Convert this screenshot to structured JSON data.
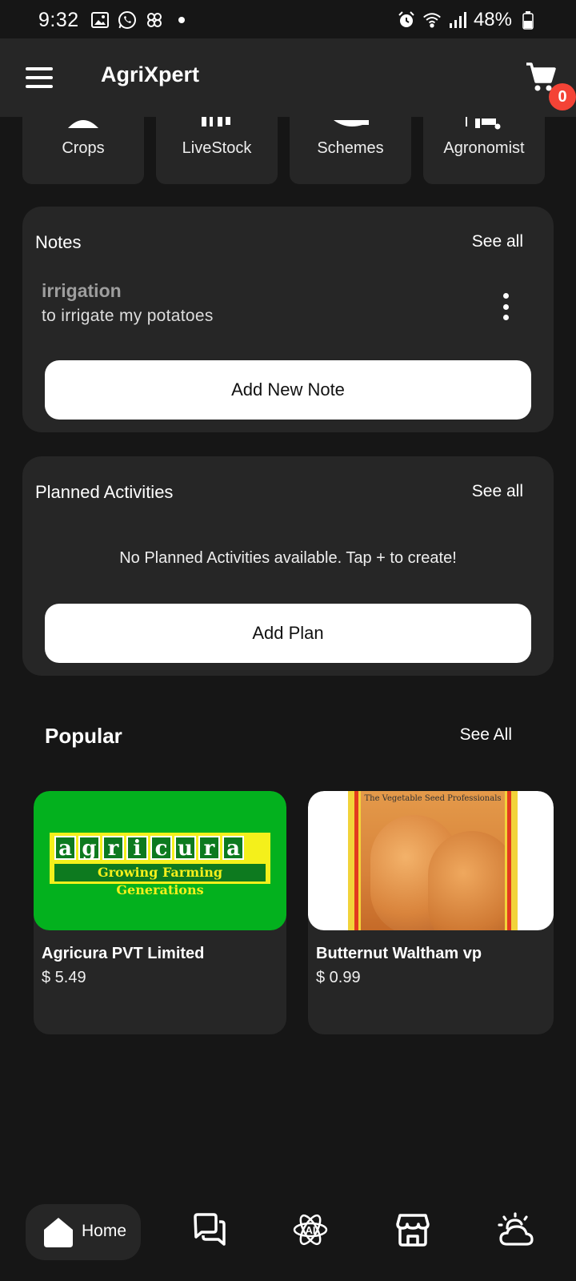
{
  "status_bar": {
    "time": "9:32",
    "battery": "48%",
    "left_icons": [
      "gallery-icon",
      "whatsapp-icon",
      "pinwheel-icon",
      "dot-icon"
    ],
    "right_icons": [
      "alarm-icon",
      "wifi-icon",
      "signal-icon",
      "battery-icon"
    ]
  },
  "app_bar": {
    "title": "AgriXpert",
    "cart_count": "0"
  },
  "categories": [
    {
      "label": "Crops",
      "icon": "crops-icon"
    },
    {
      "label": "LiveStock",
      "icon": "livestock-icon"
    },
    {
      "label": "Schemes",
      "icon": "schemes-icon"
    },
    {
      "label": "Agronomist",
      "icon": "agronomist-icon"
    }
  ],
  "notes": {
    "title": "Notes",
    "see_all": "See all",
    "items": [
      {
        "title": "irrigation",
        "body": "to irrigate my potatoes"
      }
    ],
    "add_button": "Add New Note"
  },
  "planned_activities": {
    "title": "Planned Activities",
    "see_all": "See all",
    "empty_text": "No Planned Activities available. Tap + to create!",
    "add_button": "Add Plan"
  },
  "popular": {
    "title": "Popular",
    "see_all": "See All",
    "products": [
      {
        "name": "Agricura PVT Limited",
        "price": "$ 5.49",
        "logo_word": "agricura",
        "logo_tagline": "Growing Farming Generations"
      },
      {
        "name": "Butternut Waltham vp",
        "price": "$ 0.99",
        "pack_text": "The Vegetable Seed Professionals"
      }
    ]
  },
  "bottom_nav": {
    "home_label": "Home",
    "items": [
      "chat-icon",
      "ai-atom-icon",
      "store-icon",
      "weather-icon"
    ]
  },
  "colors": {
    "background": "#161616",
    "surface": "#262626",
    "badge": "#f44336",
    "button": "#ffffff"
  }
}
